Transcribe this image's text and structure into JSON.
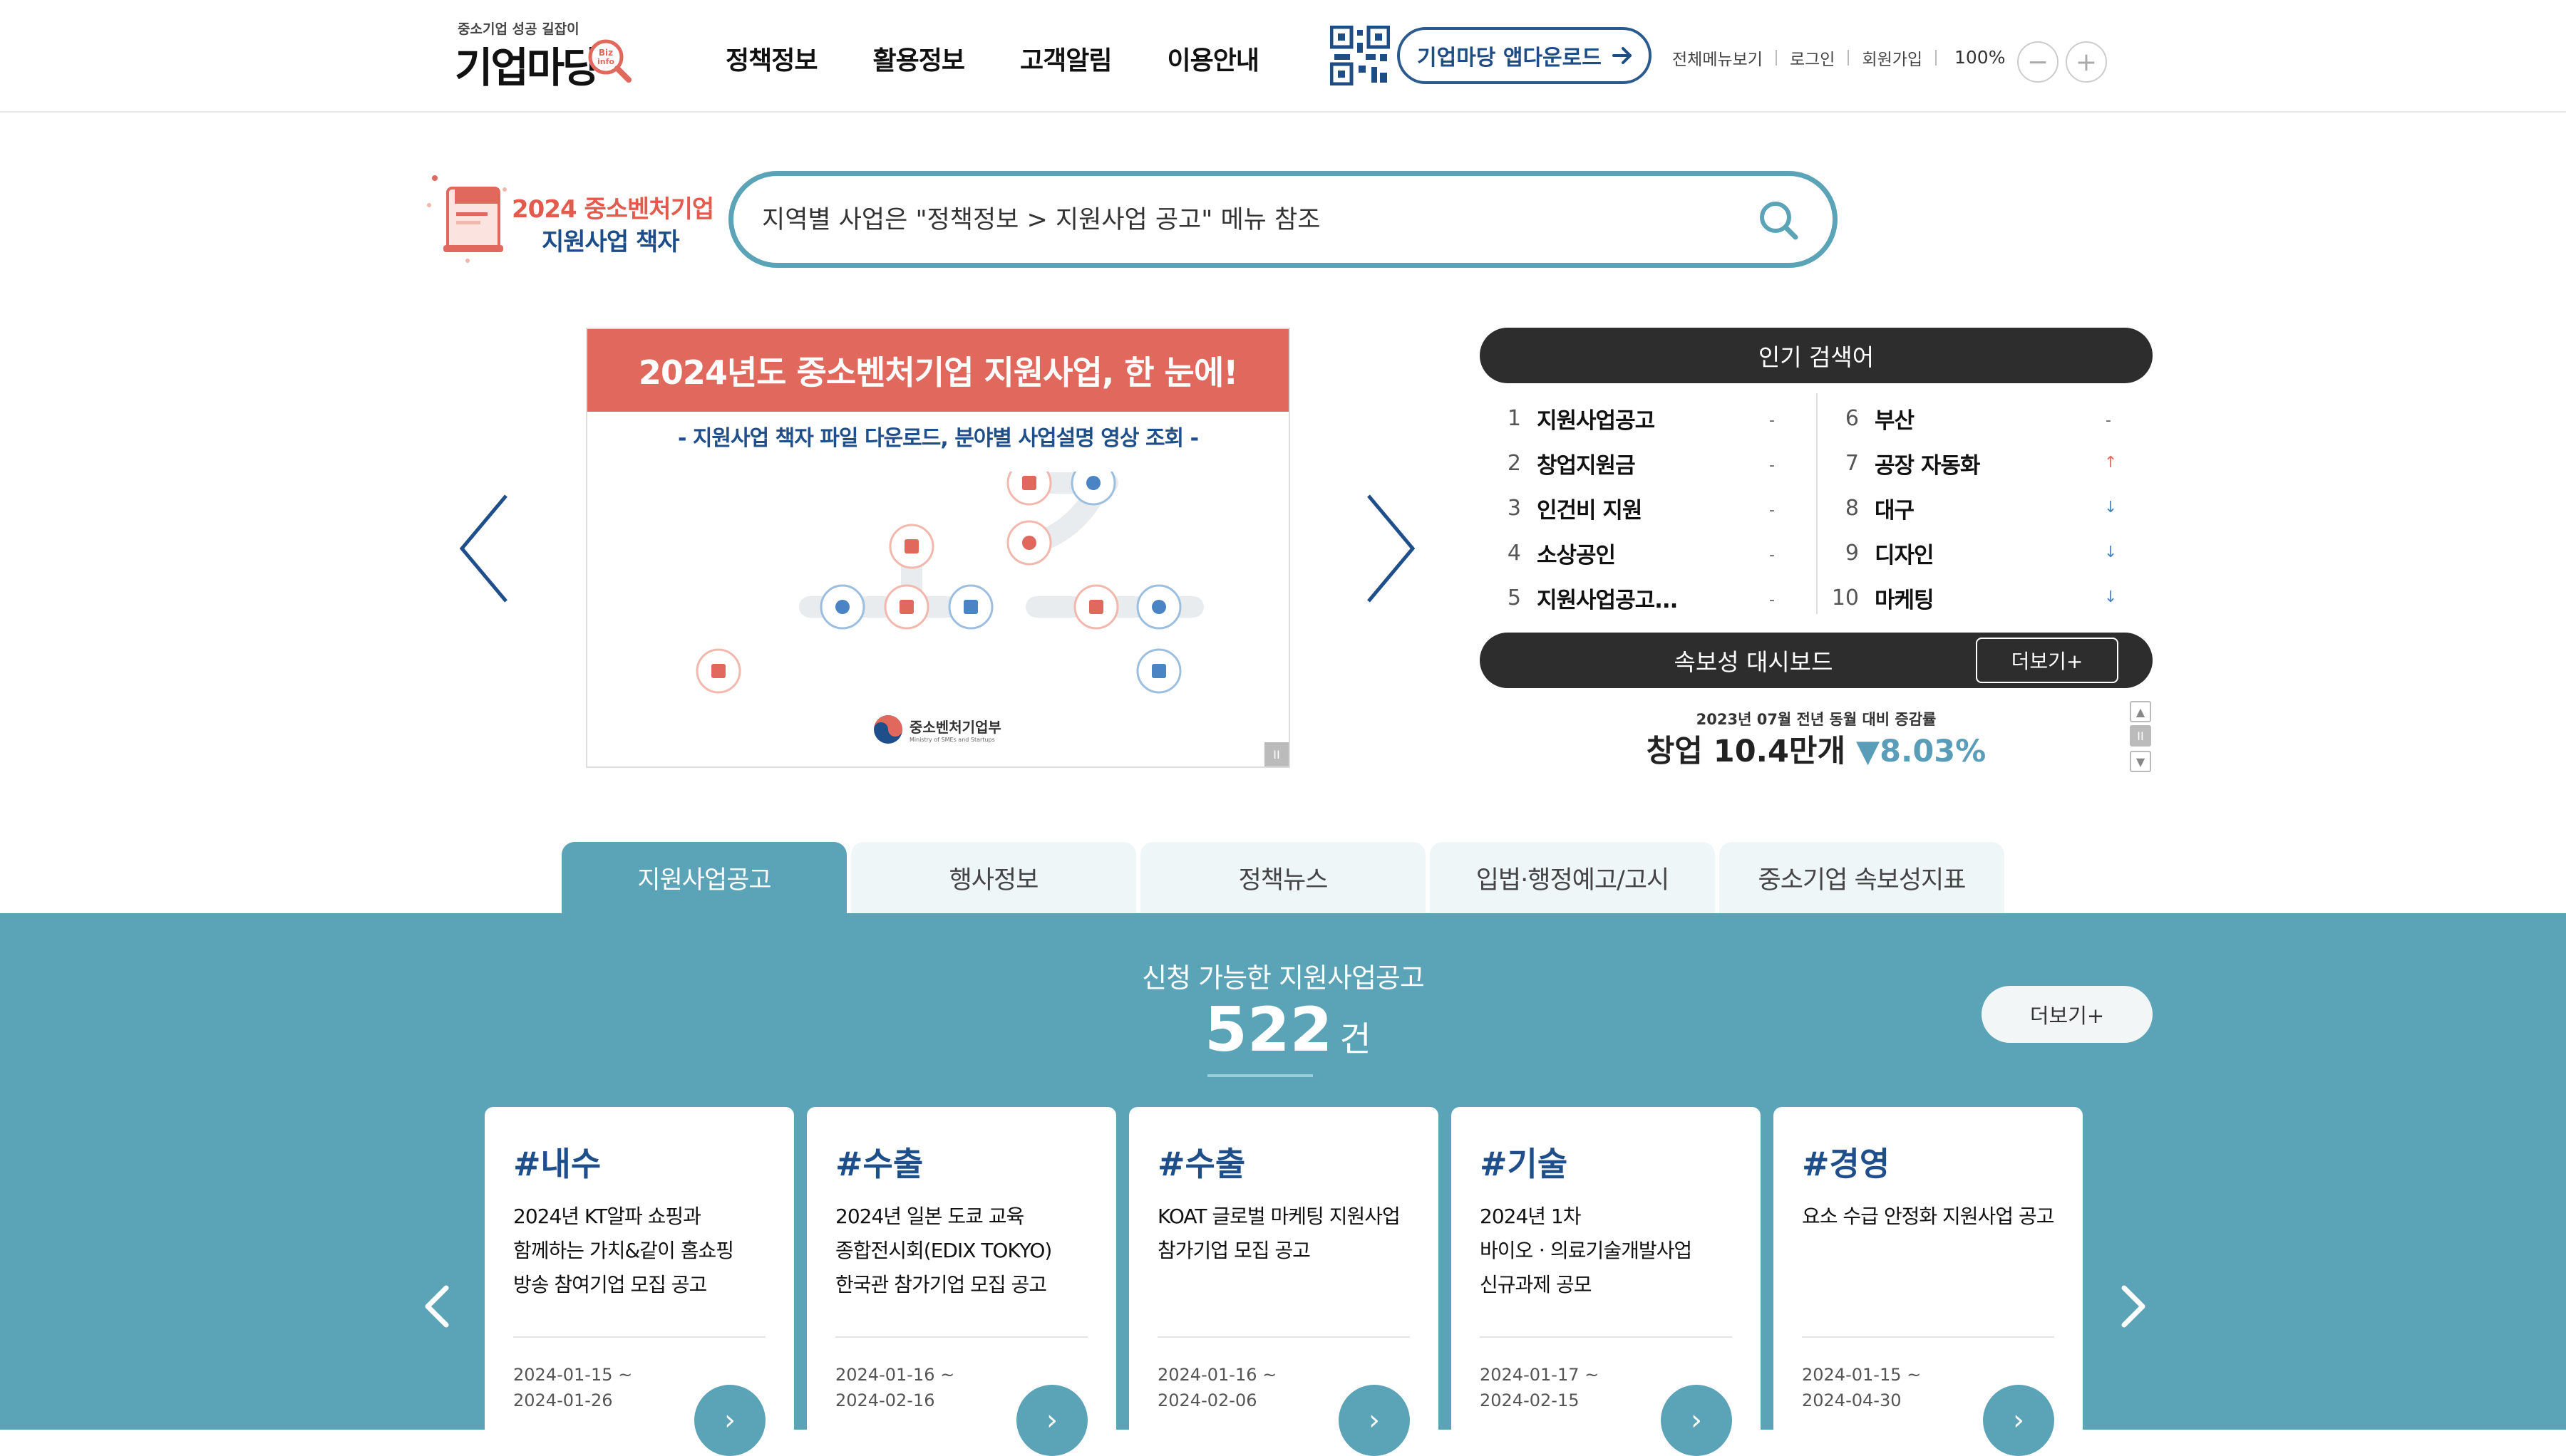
{
  "header": {
    "logo_tagline": "중소기업 성공 길잡이",
    "logo_name": "기업마당",
    "logo_badge": "Biz info",
    "nav": [
      "정책정보",
      "활용정보",
      "고객알림",
      "이용안내"
    ],
    "app_download": "기업마당 앱다운로드",
    "util_links": [
      "전체메뉴보기",
      "로그인",
      "회원가입"
    ],
    "zoom_level": "100%",
    "zoom_out": "−",
    "zoom_in": "+"
  },
  "search": {
    "banner_line1": "2024 중소벤처기업",
    "banner_line2": "지원사업 책자",
    "placeholder": "지역별 사업은 \"정책정보 > 지원사업 공고\" 메뉴 참조"
  },
  "visual": {
    "headline": "2024년도 중소벤처기업 지원사업, 한 눈에!",
    "subline": "- 지원사업 책자 파일 다운로드, 분야별 사업설명 영상 조회 -",
    "ministry": "중소벤처기업부",
    "ministry_en": "Ministry of SMEs and Startups",
    "pause": "II"
  },
  "popular": {
    "title": "인기 검색어",
    "left": [
      {
        "rank": "1",
        "keyword": "지원사업공고",
        "trend": "-",
        "trend_dir": "same"
      },
      {
        "rank": "2",
        "keyword": "창업지원금",
        "trend": "-",
        "trend_dir": "same"
      },
      {
        "rank": "3",
        "keyword": "인건비 지원",
        "trend": "-",
        "trend_dir": "same"
      },
      {
        "rank": "4",
        "keyword": "소상공인",
        "trend": "-",
        "trend_dir": "same"
      },
      {
        "rank": "5",
        "keyword": "지원사업공고...",
        "trend": "-",
        "trend_dir": "same"
      }
    ],
    "right": [
      {
        "rank": "6",
        "keyword": "부산",
        "trend": "-",
        "trend_dir": "same"
      },
      {
        "rank": "7",
        "keyword": "공장 자동화",
        "trend": "↑",
        "trend_dir": "up"
      },
      {
        "rank": "8",
        "keyword": "대구",
        "trend": "↓",
        "trend_dir": "down"
      },
      {
        "rank": "9",
        "keyword": "디자인",
        "trend": "↓",
        "trend_dir": "down"
      },
      {
        "rank": "10",
        "keyword": "마케팅",
        "trend": "↓",
        "trend_dir": "down"
      }
    ]
  },
  "dashboard": {
    "title": "속보성 대시보드",
    "more": "더보기+",
    "indicator_label": "2023년 07월 전년 동월 대비 증감률",
    "indicator_value": "창업 10.4만개",
    "indicator_rate": "▼8.03%",
    "ctrl_up": "▲",
    "ctrl_pause": "II",
    "ctrl_down": "▼"
  },
  "tabs": [
    "지원사업공고",
    "행사정보",
    "정책뉴스",
    "입법·행정예고/고시",
    "중소기업 속보성지표"
  ],
  "active_tab": 0,
  "list": {
    "title": "신청 가능한 지원사업공고",
    "count": "522",
    "unit": "건",
    "more": "더보기+",
    "cards": [
      {
        "category": "#내수",
        "title": "2024년 KT알파 쇼핑과 함께하는 가치&같이 홈쇼핑 방송 참여기업 모집 공고",
        "date_start": "2024-01-15 ~",
        "date_end": "2024-01-26"
      },
      {
        "category": "#수출",
        "title": "2024년 일본 도쿄 교육 종합전시회(EDIX TOKYO) 한국관 참가기업 모집 공고",
        "date_start": "2024-01-16 ~",
        "date_end": "2024-02-16"
      },
      {
        "category": "#수출",
        "title": "KOAT 글로벌 마케팅 지원사업 참가기업 모집 공고",
        "date_start": "2024-01-16 ~",
        "date_end": "2024-02-06"
      },
      {
        "category": "#기술",
        "title": "2024년 1차 바이오ㆍ의료기술개발사업 신규과제 공모",
        "date_start": "2024-01-17 ~",
        "date_end": "2024-02-15"
      },
      {
        "category": "#경영",
        "title": "요소 수급 안정화 지원사업 공고",
        "date_start": "2024-01-15 ~",
        "date_end": "2024-04-30"
      }
    ]
  },
  "colors": {
    "accent_teal": "#5ba3b7",
    "navy": "#1f4f8b",
    "banner_red": "#e0685c",
    "dark_pill": "#2d2d2d"
  }
}
